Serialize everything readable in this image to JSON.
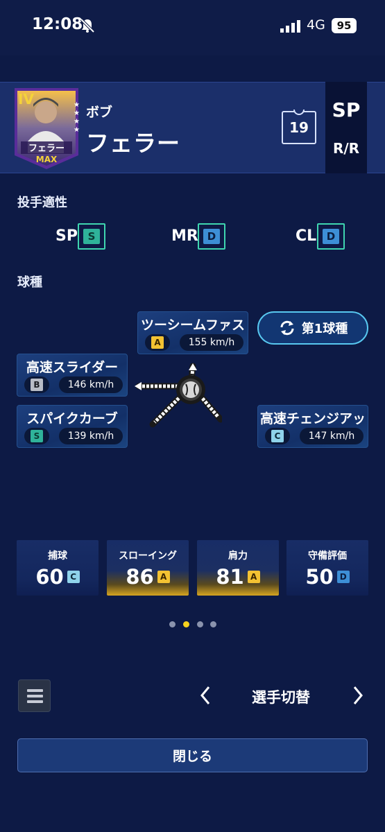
{
  "status_bar": {
    "time": "12:08",
    "network": "4G",
    "battery": "95"
  },
  "player": {
    "card_rank": "IV",
    "card_name": "フェラー",
    "card_level": "MAX",
    "first_name": "ボブ",
    "last_name": "フェラー",
    "uniform_number": "19",
    "role": "SP",
    "throw_bat": "R/R"
  },
  "aptitude": {
    "title": "投手適性",
    "items": [
      {
        "label": "SP",
        "grade": "S"
      },
      {
        "label": "MR",
        "grade": "D"
      },
      {
        "label": "CL",
        "grade": "D"
      }
    ]
  },
  "pitches": {
    "title": "球種",
    "order_button": "第1球種",
    "items": [
      {
        "name": "ツーシームファスト",
        "grade": "A",
        "speed": "155 km/h"
      },
      {
        "name": "高速スライダー",
        "grade": "B",
        "speed": "146 km/h"
      },
      {
        "name": "スパイクカーブ",
        "grade": "S",
        "speed": "139 km/h"
      },
      {
        "name": "高速チェンジアップ",
        "grade": "C",
        "speed": "147 km/h"
      }
    ]
  },
  "stats": [
    {
      "label": "捕球",
      "value": "60",
      "grade": "C"
    },
    {
      "label": "スローイング",
      "value": "86",
      "grade": "A"
    },
    {
      "label": "肩力",
      "value": "81",
      "grade": "A"
    },
    {
      "label": "守備評価",
      "value": "50",
      "grade": "D"
    }
  ],
  "pagination": {
    "total": 4,
    "active": 1
  },
  "footer": {
    "switch_label": "選手切替",
    "close_label": "閉じる"
  },
  "colors": {
    "background": "#0d1a45",
    "accent_teal": "#3fd6b0",
    "gold": "#f3c232"
  }
}
